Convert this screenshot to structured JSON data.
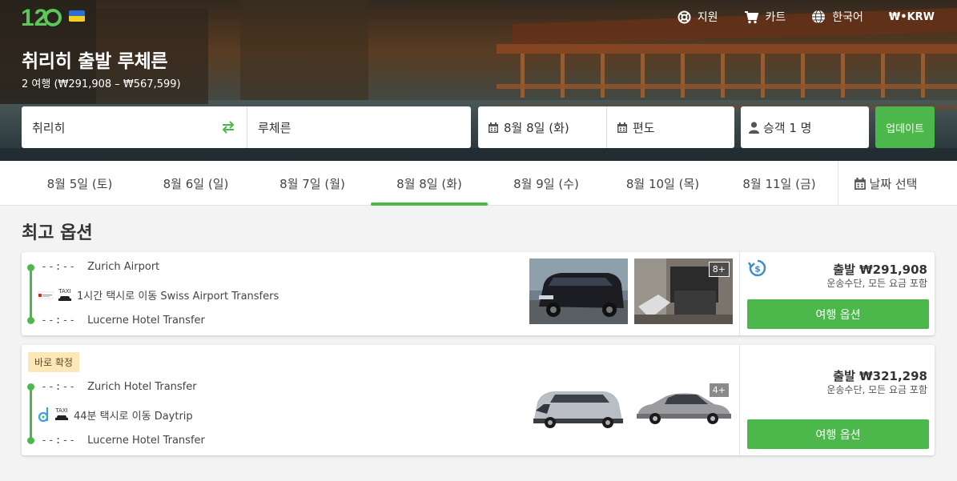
{
  "header": {
    "logo_text": "12Go",
    "nav": {
      "support": "지원",
      "cart": "카트",
      "language": "한국어",
      "currency": "₩•KRW"
    },
    "title": "취리히 출발 루체른",
    "subtitle": "2 여행 (₩291,908 – ₩567,599)"
  },
  "search": {
    "from": "취리히",
    "to": "루체른",
    "date": "8월 8일 (화)",
    "return": "편도",
    "passengers": "승객 1 명",
    "update_label": "업데이트"
  },
  "date_tabs": [
    {
      "label": "8월 5일 (토)"
    },
    {
      "label": "8월 6일 (일)"
    },
    {
      "label": "8월 7일 (월)"
    },
    {
      "label": "8월 8일 (화)",
      "active": true
    },
    {
      "label": "8월 9일 (수)"
    },
    {
      "label": "8월 10일 (목)"
    },
    {
      "label": "8월 11일 (금)"
    }
  ],
  "pick_date_label": "날짜 선택",
  "section_title": "최고 옵션",
  "results": [
    {
      "from_time": "--:--",
      "from_stop": "Zurich Airport",
      "to_time": "--:--",
      "to_stop": "Lucerne Hotel Transfer",
      "transfer_text": "1시간 택시로 이동 Swiss Airport Transfers",
      "photo_more": "8+",
      "price": "출발 ₩291,908",
      "price_note": "운송수단, 모든 요금 포함",
      "button": "여행 옵션"
    },
    {
      "badge": "바로 확정",
      "from_time": "--:--",
      "from_stop": "Zurich Hotel Transfer",
      "to_time": "--:--",
      "to_stop": "Lucerne Hotel Transfer",
      "transfer_text": "44분 택시로 이동 Daytrip",
      "photo_more": "4+",
      "price": "출발 ₩321,298",
      "price_note": "운송수단, 모든 요금 포함",
      "button": "여행 옵션"
    }
  ],
  "taxi_label": "TAXI",
  "colors": {
    "accent": "#4cb84c",
    "badge_bg": "#fde7b8",
    "refund_icon": "#3d8fc4"
  }
}
